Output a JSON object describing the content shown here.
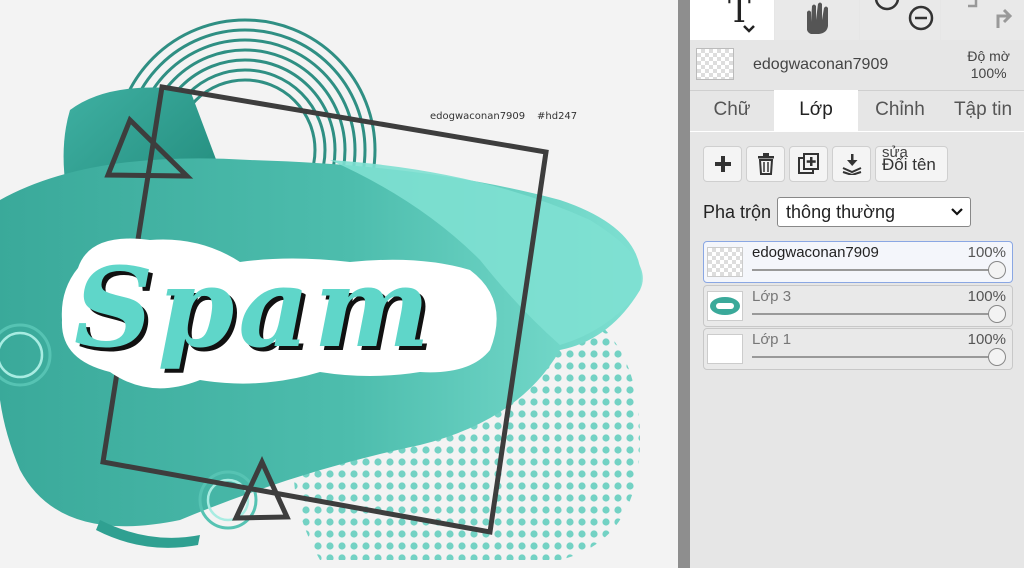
{
  "canvas": {
    "watermark_user": "edogwaconan7909",
    "watermark_tag": "#hd247",
    "artwork_text": "Spam"
  },
  "toolbar": {
    "text_tool_icon": "text-tool-icon",
    "hand_tool_icon": "hand-icon",
    "zoom_in_icon": "zoom-in-icon",
    "zoom_out_icon": "zoom-out-icon",
    "undo_icon": "undo-icon",
    "redo_icon": "redo-icon"
  },
  "selected_layer": {
    "name": "edogwaconan7909",
    "opacity_label": "Độ mờ",
    "opacity_value": "100%"
  },
  "tabs": [
    {
      "label": "Chữ",
      "active": false
    },
    {
      "label": "Lớp",
      "active": true
    },
    {
      "label": "Chỉnh",
      "active": false
    },
    {
      "label": "Tập tin",
      "active": false
    }
  ],
  "layer_buttons": {
    "add": "add-layer-icon",
    "delete": "trash-icon",
    "duplicate": "duplicate-icon",
    "merge": "merge-down-icon",
    "rename_top": "sửa",
    "rename": "Đổi tên"
  },
  "blend": {
    "label": "Pha trộn",
    "value": "thông thường"
  },
  "layers": [
    {
      "name": "edogwaconan7909",
      "opacity": "100%",
      "active": true
    },
    {
      "name": "Lớp 3",
      "opacity": "100%",
      "active": false
    },
    {
      "name": "Lớp 1",
      "opacity": "100%",
      "active": false
    }
  ],
  "colors": {
    "teal_dark": "#2a9d8f",
    "teal_light": "#7fe0d2",
    "accent_blue": "#8aa7e3"
  }
}
